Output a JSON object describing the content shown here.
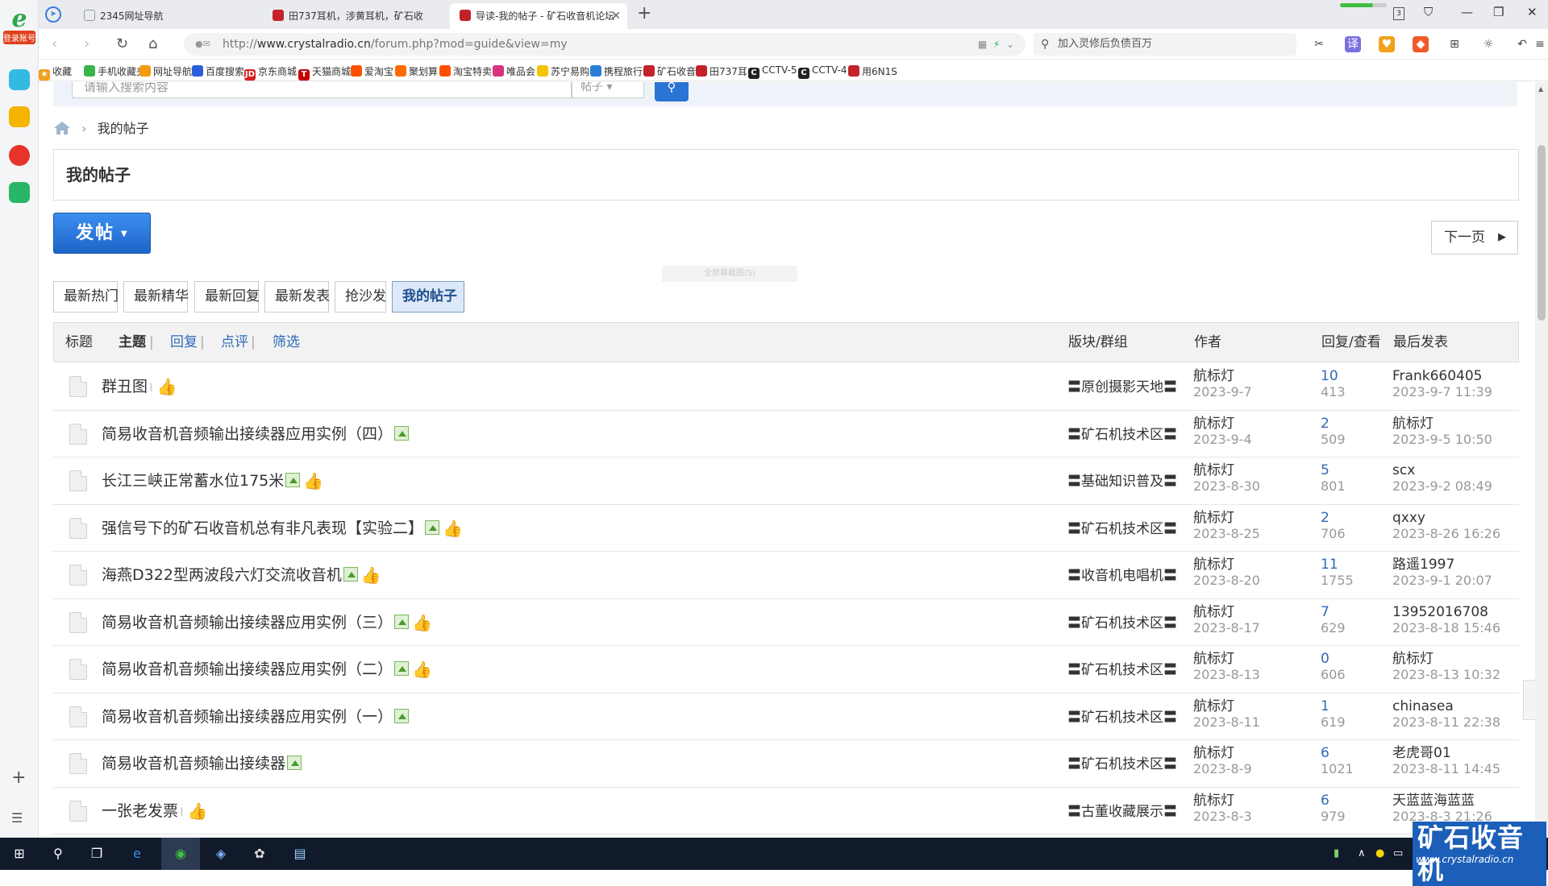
{
  "sidebar": {
    "logo": "e",
    "login": "登录账号"
  },
  "tabs": [
    {
      "label": "2345网址导航",
      "active": false
    },
    {
      "label": "田737耳机，涉黄耳机，矿石收",
      "active": false
    },
    {
      "label": "导读-我的帖子 - 矿石收音机论坛",
      "active": true
    }
  ],
  "tab_badge": "3",
  "address": {
    "protocol": "http://",
    "host": "www.crystalradio.cn",
    "path": "/forum.php?mod=guide&view=my"
  },
  "search_box": {
    "placeholder": "加入灵修后负债百万"
  },
  "bookmarks": [
    {
      "label": "收藏",
      "color": "#f0a020",
      "glyph": "★"
    },
    {
      "label": "手机收藏夹",
      "color": "#3ab54a",
      "glyph": ""
    },
    {
      "label": "网址导航",
      "color": "#f39c12",
      "glyph": ""
    },
    {
      "label": "百度搜索",
      "color": "#2b5fd9",
      "glyph": ""
    },
    {
      "label": "京东商城",
      "color": "#d71c1e",
      "glyph": "JD"
    },
    {
      "label": "天猫商城",
      "color": "#c40000",
      "glyph": "T"
    },
    {
      "label": "爱淘宝",
      "color": "#ff5000",
      "glyph": ""
    },
    {
      "label": "聚划算",
      "color": "#ff6a00",
      "glyph": ""
    },
    {
      "label": "淘宝特卖",
      "color": "#ff5000",
      "glyph": ""
    },
    {
      "label": "唯品会",
      "color": "#d9327e",
      "glyph": ""
    },
    {
      "label": "苏宁易购",
      "color": "#f5c400",
      "glyph": ""
    },
    {
      "label": "携程旅行",
      "color": "#2a7ed8",
      "glyph": ""
    },
    {
      "label": "矿石收音",
      "color": "#c3222a",
      "glyph": ""
    },
    {
      "label": "田737耳",
      "color": "#c3222a",
      "glyph": ""
    },
    {
      "label": "CCTV-5",
      "color": "#222",
      "glyph": "C"
    },
    {
      "label": "CCTV-4",
      "color": "#222",
      "glyph": "C"
    },
    {
      "label": "用6N1S",
      "color": "#c3222a",
      "glyph": ""
    }
  ],
  "forum_search": {
    "placeholder": "请输入搜索内容",
    "scope": "帖子"
  },
  "breadcrumb": {
    "current": "我的帖子"
  },
  "page_title": "我的帖子",
  "post_button": "发帖",
  "next_page": "下一页",
  "hint": "全屏幕截图(S)",
  "filters": [
    {
      "label": "最新热门",
      "active": false
    },
    {
      "label": "最新精华",
      "active": false
    },
    {
      "label": "最新回复",
      "active": false
    },
    {
      "label": "最新发表",
      "active": false
    },
    {
      "label": "抢沙发",
      "active": false
    },
    {
      "label": "我的帖子",
      "active": true
    }
  ],
  "table_header": {
    "title": "标题",
    "tabs": [
      "主题",
      "回复",
      "点评",
      "筛选"
    ],
    "forum": "版块/群组",
    "author": "作者",
    "counts": "回复/查看",
    "last": "最后发表"
  },
  "threads": [
    {
      "title": "群丑图",
      "attach": true,
      "image": false,
      "thumb": true,
      "forum": "〓原创摄影天地〓",
      "author": "航标灯",
      "date": "2023-9-7",
      "replies": "10",
      "views": "413",
      "last_user": "Frank660405",
      "last_time": "2023-9-7 11:39"
    },
    {
      "title": "简易收音机音频输出接续器应用实例（四）",
      "attach": false,
      "image": true,
      "thumb": false,
      "forum": "〓矿石机技术区〓",
      "author": "航标灯",
      "date": "2023-9-4",
      "replies": "2",
      "views": "509",
      "last_user": "航标灯",
      "last_time": "2023-9-5 10:50"
    },
    {
      "title": "长江三峡正常蓄水位175米",
      "attach": false,
      "image": true,
      "thumb": true,
      "forum": "〓基础知识普及〓",
      "author": "航标灯",
      "date": "2023-8-30",
      "replies": "5",
      "views": "801",
      "last_user": "scx",
      "last_time": "2023-9-2 08:49"
    },
    {
      "title": "强信号下的矿石收音机总有非凡表现【实验二】",
      "attach": false,
      "image": true,
      "thumb": true,
      "forum": "〓矿石机技术区〓",
      "author": "航标灯",
      "date": "2023-8-25",
      "replies": "2",
      "views": "706",
      "last_user": "qxxy",
      "last_time": "2023-8-26 16:26"
    },
    {
      "title": "海燕D322型两波段六灯交流收音机",
      "attach": false,
      "image": true,
      "thumb": true,
      "forum": "〓收音机电唱机〓",
      "author": "航标灯",
      "date": "2023-8-20",
      "replies": "11",
      "views": "1755",
      "last_user": "路遥1997",
      "last_time": "2023-9-1 20:07"
    },
    {
      "title": "简易收音机音频输出接续器应用实例（三）",
      "attach": false,
      "image": true,
      "thumb": true,
      "forum": "〓矿石机技术区〓",
      "author": "航标灯",
      "date": "2023-8-17",
      "replies": "7",
      "views": "629",
      "last_user": "13952016708",
      "last_time": "2023-8-18 15:46"
    },
    {
      "title": "简易收音机音频输出接续器应用实例（二）",
      "attach": false,
      "image": true,
      "thumb": true,
      "forum": "〓矿石机技术区〓",
      "author": "航标灯",
      "date": "2023-8-13",
      "replies": "0",
      "views": "606",
      "last_user": "航标灯",
      "last_time": "2023-8-13 10:32"
    },
    {
      "title": "简易收音机音频输出接续器应用实例（一）",
      "attach": false,
      "image": true,
      "thumb": false,
      "forum": "〓矿石机技术区〓",
      "author": "航标灯",
      "date": "2023-8-11",
      "replies": "1",
      "views": "619",
      "last_user": "chinasea",
      "last_time": "2023-8-11 22:38"
    },
    {
      "title": "简易收音机音频输出接续器",
      "attach": false,
      "image": true,
      "thumb": false,
      "forum": "〓矿石机技术区〓",
      "author": "航标灯",
      "date": "2023-8-9",
      "replies": "6",
      "views": "1021",
      "last_user": "老虎哥01",
      "last_time": "2023-8-11 14:45"
    },
    {
      "title": "一张老发票",
      "attach": true,
      "image": false,
      "thumb": true,
      "forum": "〓古董收藏展示〓",
      "author": "航标灯",
      "date": "2023-8-3",
      "replies": "6",
      "views": "979",
      "last_user": "天蓝蓝海蓝蓝",
      "last_time": "2023-8-3 21:26"
    }
  ],
  "watermark": {
    "name": "矿石收音机",
    "url": "www.crystalradio.cn"
  },
  "colors": {
    "accent": "#2a74d4",
    "link": "#2e6ab8",
    "active_filter_bg": "#dde9f8"
  }
}
